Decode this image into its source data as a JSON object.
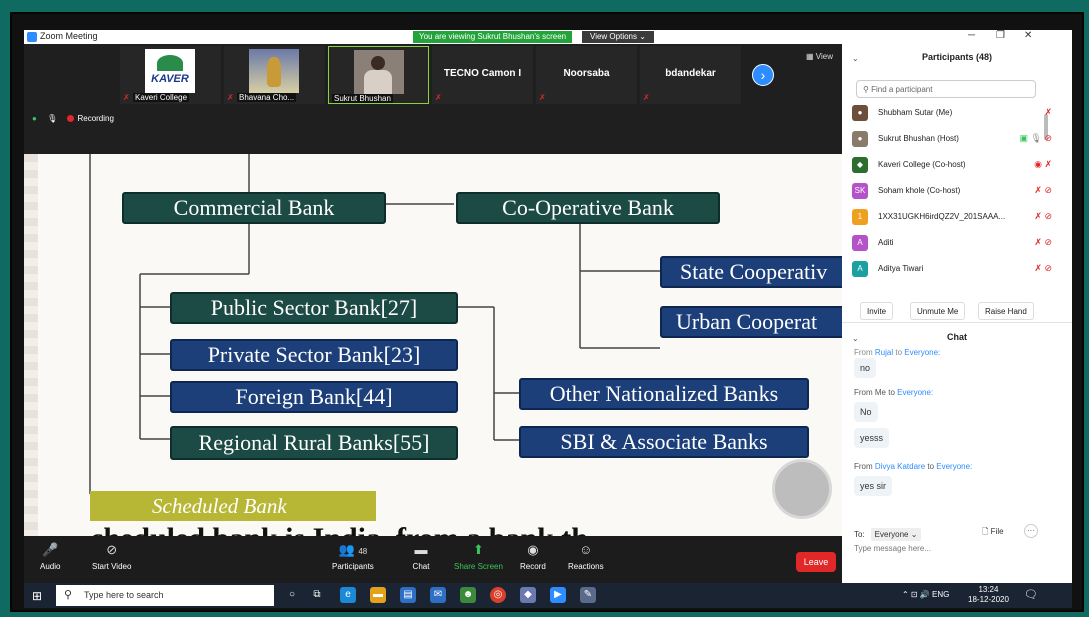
{
  "window": {
    "title": "Zoom Meeting",
    "viewing_banner": "You are viewing Sukrut Bhushan's screen",
    "view_options": "View Options"
  },
  "thumbnails": [
    {
      "label": "Kaveri College"
    },
    {
      "label": "Bhavana Cho..."
    },
    {
      "label": "Sukrut Bhushan"
    },
    {
      "label": "TECNO Camon I"
    },
    {
      "label": "Noorsaba"
    },
    {
      "label": "bdandekar"
    }
  ],
  "logo_text": "KAVER",
  "view_label": "View",
  "recording_label": "Recording",
  "slide": {
    "commercial": "Commercial Bank",
    "cooperative": "Co-Operative Bank",
    "state_coop": "State Cooperativ",
    "urban_coop": "Urban Cooperat",
    "public": "Public Sector Bank[27]",
    "private": "Private Sector Bank[23]",
    "foreign": "Foreign Bank[44]",
    "rrb": "Regional Rural Banks[55]",
    "other_nat": "Other Nationalized Banks",
    "sbi": "SBI & Associate Banks",
    "scheduled": "Scheduled Bank",
    "partial_line": "cheduled bank is India, from a bank th"
  },
  "toolbar": {
    "audio": "Audio",
    "start_video": "Start Video",
    "participants": "Participants",
    "participants_count": "48",
    "chat": "Chat",
    "share_screen": "Share Screen",
    "record": "Record",
    "reactions": "Reactions",
    "leave": "Leave"
  },
  "panel": {
    "participants_title": "Participants (48)",
    "search_placeholder": "Find a participant",
    "participants": [
      {
        "name": "Shubham Sutar (Me)",
        "avatar": "",
        "color": "#6b4f3a"
      },
      {
        "name": "Sukrut Bhushan (Host)",
        "avatar": "",
        "color": "#8a7a6a"
      },
      {
        "name": "Kaveri College (Co-host)",
        "avatar": "",
        "color": "#2c6e2c"
      },
      {
        "name": "Soham khole (Co-host)",
        "avatar": "SK",
        "color": "#b452c8"
      },
      {
        "name": "1XX31UGKH6irdQZ2V_201SAAA...",
        "avatar": "1",
        "color": "#f0a020"
      },
      {
        "name": "Aditi",
        "avatar": "A",
        "color": "#b452c8"
      },
      {
        "name": "Aditya Tiwari",
        "avatar": "A",
        "color": "#1aa0a0"
      }
    ],
    "invite": "Invite",
    "unmute_me": "Unmute Me",
    "raise_hand": "Raise Hand",
    "chat_title": "Chat",
    "messages": [
      {
        "meta_from": "From ",
        "meta_name": "Rujal",
        "meta_to": " to ",
        "meta_target": "Everyone:",
        "text": "no"
      },
      {
        "meta_from": "From Me to ",
        "meta_name": "",
        "meta_to": "",
        "meta_target": "Everyone:",
        "text": "No"
      },
      {
        "meta_from": "",
        "meta_name": "",
        "meta_to": "",
        "meta_target": "",
        "text": "yesss"
      },
      {
        "meta_from": "From ",
        "meta_name": "Divya Katdare",
        "meta_to": " to ",
        "meta_target": "Everyone:",
        "text": "yes sir"
      }
    ],
    "to_label": "To:",
    "to_value": "Everyone",
    "file_label": "File",
    "input_placeholder": "Type message here..."
  },
  "taskbar": {
    "search_placeholder": "Type here to search",
    "lang": "ENG",
    "time": "13:24",
    "date": "18-12-2020"
  }
}
